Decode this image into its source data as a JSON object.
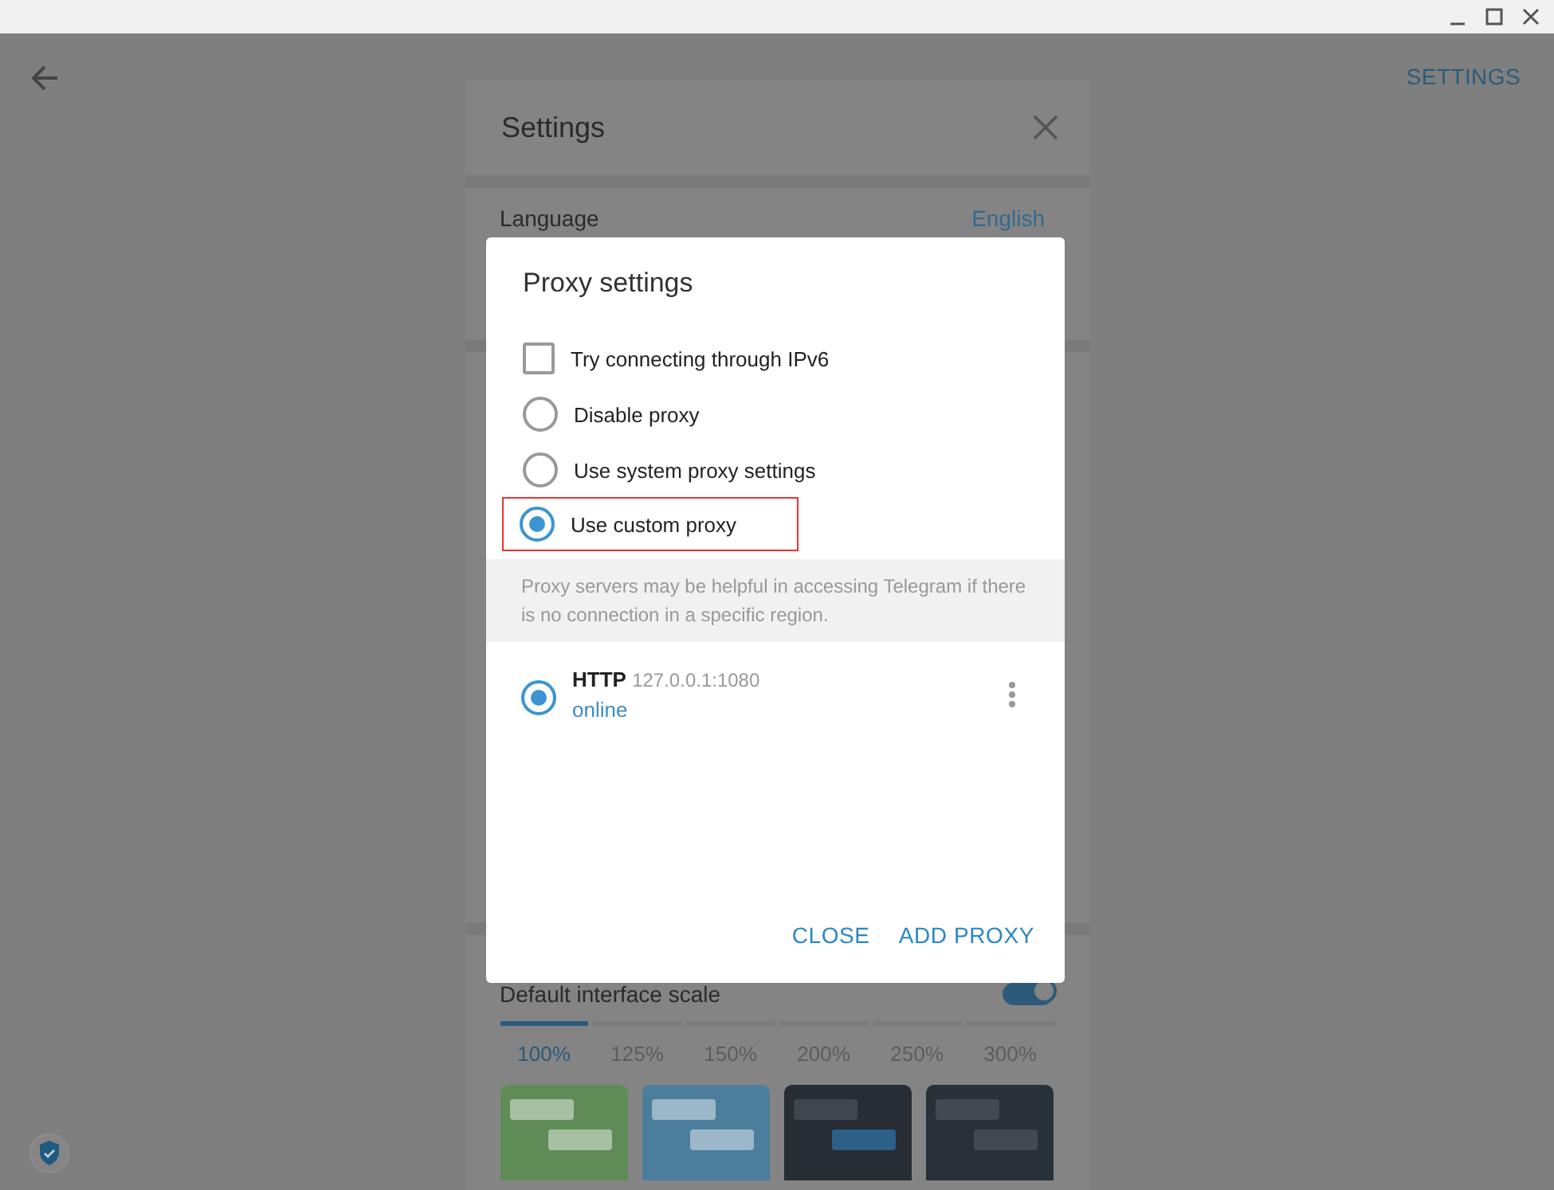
{
  "header": {
    "action": "SETTINGS"
  },
  "settings": {
    "title": "Settings",
    "language": {
      "label": "Language",
      "value": "English"
    },
    "scale": {
      "label": "Default interface scale",
      "on": true,
      "options": [
        {
          "label": "100%",
          "selected": true
        },
        {
          "label": "125%",
          "selected": false
        },
        {
          "label": "150%",
          "selected": false
        },
        {
          "label": "200%",
          "selected": false
        },
        {
          "label": "250%",
          "selected": false
        },
        {
          "label": "300%",
          "selected": false
        }
      ]
    },
    "themes": [
      {
        "kind": "plain",
        "color": "#5f8b57"
      },
      {
        "kind": "plain",
        "color": "#4b7d9c"
      },
      {
        "kind": "accent",
        "color": "#262d35"
      },
      {
        "kind": "plain",
        "color": "#283038"
      }
    ]
  },
  "dialog": {
    "title": "Proxy settings",
    "options": [
      {
        "kind": "checkbox",
        "label": "Try connecting through IPv6",
        "checked": false
      },
      {
        "kind": "radio",
        "label": "Disable proxy",
        "selected": false
      },
      {
        "kind": "radio",
        "label": "Use system proxy settings",
        "selected": false
      },
      {
        "kind": "radio",
        "label": "Use custom proxy",
        "selected": true,
        "highlighted": true
      }
    ],
    "note": "Proxy servers may be helpful in accessing Telegram if there is no connection in a specific region.",
    "proxies": [
      {
        "type": "HTTP",
        "address": "127.0.0.1:1080",
        "status": "online",
        "selected": true
      }
    ],
    "buttons": [
      "CLOSE",
      "ADD PROXY"
    ]
  }
}
